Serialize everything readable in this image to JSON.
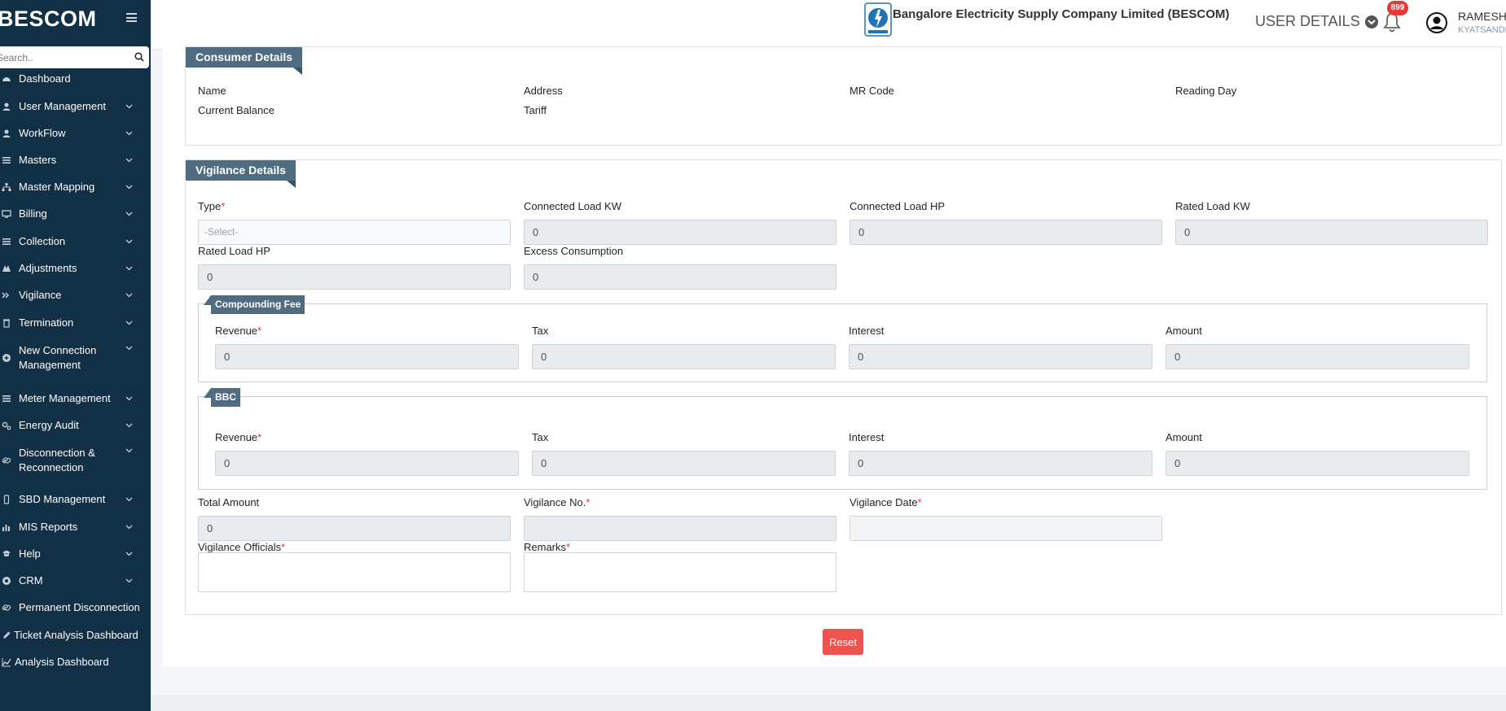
{
  "sidebar": {
    "brand": "BESCOM",
    "search_placeholder": "Search..",
    "items": [
      {
        "label": "Dashboard",
        "icon": "dashboard-icon",
        "chevron": false
      },
      {
        "label": "User Management",
        "icon": "user-icon",
        "chevron": true
      },
      {
        "label": "WorkFlow",
        "icon": "user-icon",
        "chevron": true
      },
      {
        "label": "Masters",
        "icon": "list-icon",
        "chevron": true
      },
      {
        "label": "Master Mapping",
        "icon": "sitemap-icon",
        "chevron": true
      },
      {
        "label": "Billing",
        "icon": "monitor-icon",
        "chevron": true
      },
      {
        "label": "Collection",
        "icon": "list-icon",
        "chevron": true
      },
      {
        "label": "Adjustments",
        "icon": "adjust-icon",
        "chevron": true
      },
      {
        "label": "Vigilance",
        "icon": "vigilance-icon",
        "chevron": true
      },
      {
        "label": "Termination",
        "icon": "trash-icon",
        "chevron": true
      },
      {
        "label": "New Connection Management",
        "icon": "plus-circle-icon",
        "chevron": true
      },
      {
        "label": "Meter Management",
        "icon": "list-icon",
        "chevron": true
      },
      {
        "label": "Energy Audit",
        "icon": "gears-icon",
        "chevron": true
      },
      {
        "label": "Disconnection & Reconnection",
        "icon": "link-icon",
        "chevron": true
      },
      {
        "label": "SBD Management",
        "icon": "mobile-icon",
        "chevron": true
      },
      {
        "label": "MIS Reports",
        "icon": "bar-chart-icon",
        "chevron": true
      },
      {
        "label": "Help",
        "icon": "help-icon",
        "chevron": true
      },
      {
        "label": "CRM",
        "icon": "crm-icon",
        "chevron": true
      },
      {
        "label": "Permanent Disconnection",
        "icon": "link-icon",
        "chevron": false
      },
      {
        "label": "Ticket Analysis Dashboard",
        "icon": "pencil-icon",
        "chevron": false
      },
      {
        "label": "Analysis Dashboard",
        "icon": "line-chart-icon",
        "chevron": false
      }
    ]
  },
  "header": {
    "company": "Bangalore Electricity Supply Company Limited (BESCOM)",
    "user_details": "USER DETAILS",
    "notifications": "899",
    "user_name": "RAMESH",
    "user_location": "KYATSANDRA"
  },
  "consumer": {
    "title": "Consumer Details",
    "labels": [
      "Name",
      "Address",
      "MR Code",
      "Reading Day",
      "Current Balance",
      "Tariff"
    ]
  },
  "vigilance": {
    "title": "Vigilance Details",
    "type_label": "Type",
    "type_value": "-Select-",
    "connected_load_kw": {
      "label": "Connected Load KW",
      "value": "0"
    },
    "connected_load_hp": {
      "label": "Connected Load HP",
      "value": "0"
    },
    "rated_load_kw": {
      "label": "Rated Load KW",
      "value": "0"
    },
    "rated_load_hp": {
      "label": "Rated Load HP",
      "value": "0"
    },
    "excess_consumption": {
      "label": "Excess Consumption",
      "value": "0"
    },
    "compounding_fee": {
      "title": "Compounding Fee",
      "revenue_label": "Revenue",
      "revenue": "0",
      "tax_label": "Tax",
      "tax": "0",
      "interest_label": "Interest",
      "interest": "0",
      "amount_label": "Amount",
      "amount": "0"
    },
    "bbc": {
      "title": "BBC",
      "revenue_label": "Revenue",
      "revenue": "0",
      "tax_label": "Tax",
      "tax": "0",
      "interest_label": "Interest",
      "interest": "0",
      "amount_label": "Amount",
      "amount": "0"
    },
    "total_amount": {
      "label": "Total Amount",
      "value": "0"
    },
    "vigilance_no_label": "Vigilance No.",
    "vigilance_date_label": "Vigilance Date",
    "officials_label": "Vigilance Officials",
    "remarks_label": "Remarks",
    "reset_label": "Reset"
  },
  "colors": {
    "sidebar_bg": "#112f45",
    "ribbon": "#4f6c80",
    "reset": "#ef5350",
    "required": "#dc3545"
  }
}
